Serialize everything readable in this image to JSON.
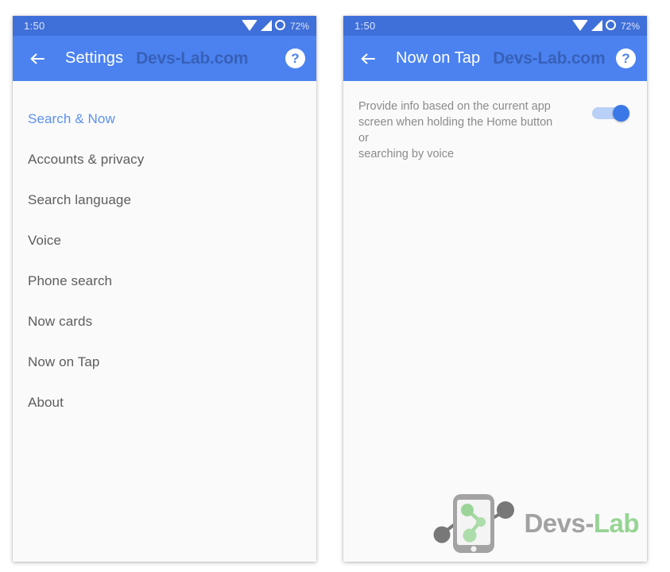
{
  "accent": {
    "status_bar_blue": "#3f6fd8",
    "app_bar_blue": "#4b82f0",
    "selected_item_blue": "#5b91f0",
    "switch_on_blue": "#3b78e7",
    "panel_background": "#fafafa",
    "logo_green": "#8fd18c",
    "logo_gray": "#9b9b9b"
  },
  "status_bar": {
    "time": "1:50",
    "battery_percent": "72%",
    "icons": [
      "wifi-icon",
      "cell-signal-icon",
      "battery-charging-ring-icon"
    ]
  },
  "watermark": {
    "site": "Devs-Lab.com",
    "logo_text_primary": "Devs-",
    "logo_text_secondary": "Lab",
    "logo_icon": "devs-lab-smartphone-network-logo"
  },
  "left_screen": {
    "app_bar": {
      "back_icon": "back-arrow-icon",
      "title": "Settings",
      "help_icon": "help-question-mark-icon"
    },
    "items": [
      {
        "label": "Search & Now",
        "selected": true
      },
      {
        "label": "Accounts & privacy",
        "selected": false
      },
      {
        "label": "Search language",
        "selected": false
      },
      {
        "label": "Voice",
        "selected": false
      },
      {
        "label": "Phone search",
        "selected": false
      },
      {
        "label": "Now cards",
        "selected": false
      },
      {
        "label": "Now on Tap",
        "selected": false
      },
      {
        "label": "About",
        "selected": false
      }
    ]
  },
  "right_screen": {
    "app_bar": {
      "back_icon": "back-arrow-icon",
      "title": "Now on Tap",
      "help_icon": "help-question-mark-icon"
    },
    "setting": {
      "description": "Provide info based on the current app\nscreen when holding the Home button or\nsearching by voice",
      "toggle_state": "on"
    }
  }
}
